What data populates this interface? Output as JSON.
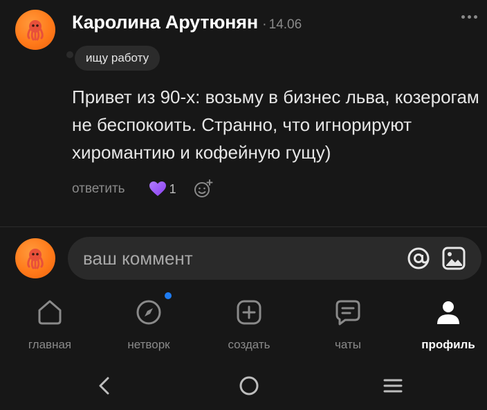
{
  "post": {
    "author": "Каролина Арутюнян",
    "separator": "·",
    "date": "14.06",
    "badge": "ищу работу",
    "text": "Привет из 90-х: возьму в бизнес льва, козерогам не беспокоить. Странно, что игнорируют хиромантию и кофейную гущу)",
    "reply_label": "ответить",
    "like_count": "1",
    "heart_color": "#9b5cf6"
  },
  "composer": {
    "placeholder": "ваш коммент"
  },
  "tabs": [
    {
      "label": "главная",
      "icon": "home-icon"
    },
    {
      "label": "нетворк",
      "icon": "compass-icon"
    },
    {
      "label": "создать",
      "icon": "plus-square-icon"
    },
    {
      "label": "чаты",
      "icon": "chat-icon"
    },
    {
      "label": "профиль",
      "icon": "profile-icon",
      "active": true
    }
  ],
  "colors": {
    "background": "#171717",
    "avatar": "#ff7a1a",
    "notification_dot": "#1e7cf2"
  }
}
